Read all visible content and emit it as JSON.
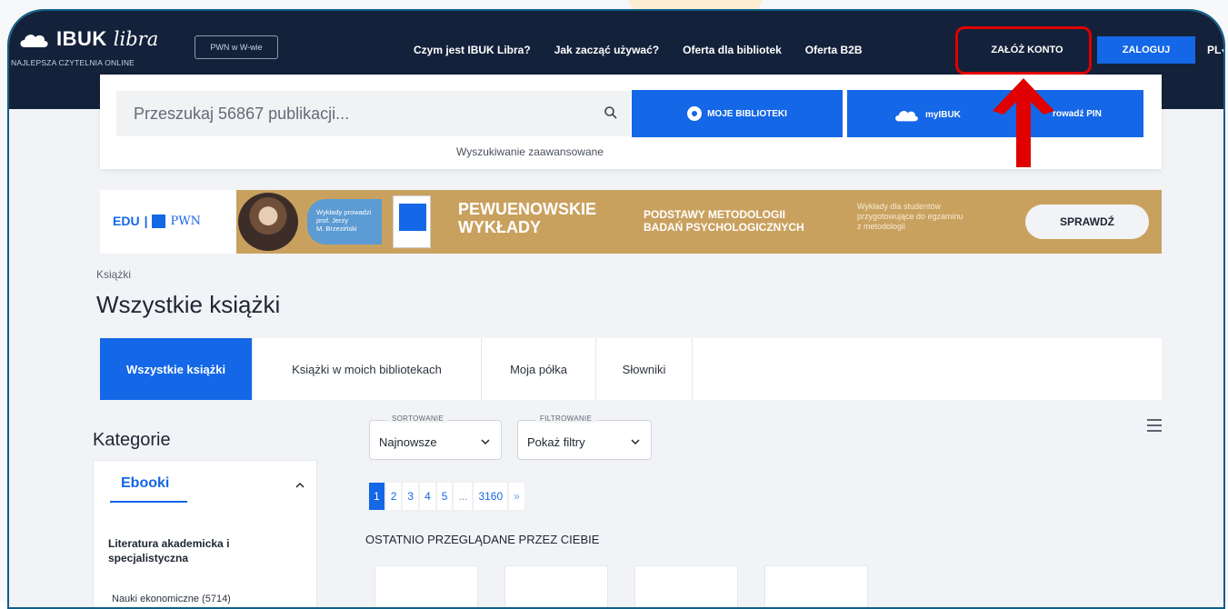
{
  "header": {
    "logo_main": "IBUK",
    "logo_script": "libra",
    "tagline": "NAJLEPSZA CZYTELNIA ONLINE",
    "pwn_button": "PWN w W-wie",
    "nav": [
      "Czym jest IBUK Libra?",
      "Jak zacząć używać?",
      "Oferta dla bibliotek",
      "Oferta B2B"
    ],
    "register_button": "ZAŁÓŻ KONTO",
    "login_button": "ZALOGUJ",
    "language": "PL"
  },
  "search": {
    "placeholder": "Przeszukaj 56867 publikacji...",
    "advanced_link": "Wyszukiwanie zaawansowane",
    "my_libraries_button": "MOJE BIBLIOTEKI",
    "mybuk_button": "myIBUK",
    "pin_button": "rowadź PIN"
  },
  "banner": {
    "brand": "EDU",
    "brand2": "PWN",
    "lecturer_line1": "Wykłady prowadzi",
    "lecturer_line2": "prof. Jerzy",
    "lecturer_line3": "M. Brzeziński",
    "title_line1": "PEWUENOWSKIE",
    "title_line2": "WYKŁADY",
    "subtitle_line1": "PODSTAWY METODOLOGII",
    "subtitle_line2": "BADAŃ PSYCHOLOGICZNYCH",
    "desc_line1": "Wykłady dla studentów",
    "desc_line2": "przygotowujące do egzaminu",
    "desc_line3": "z metodologii",
    "cta": "SPRAWDŹ"
  },
  "page": {
    "breadcrumb": "Książki",
    "title": "Wszystkie książki"
  },
  "tabs": [
    {
      "label": "Wszystkie książki",
      "active": true
    },
    {
      "label": "Książki w moich bibliotekach",
      "active": false
    },
    {
      "label": "Moja półka",
      "active": false
    },
    {
      "label": "Słowniki",
      "active": false
    }
  ],
  "sidebar": {
    "heading": "Kategorie",
    "section": "Ebooki",
    "main_category": "Literatura akademicka i specjalistyczna",
    "sub_category": "Nauki ekonomiczne (5714)"
  },
  "controls": {
    "sort_label": "SORTOWANIE",
    "sort_value": "Najnowsze",
    "filter_label": "FILTROWANIE",
    "filter_value": "Pokaż filtry"
  },
  "pagination": [
    "1",
    "2",
    "3",
    "4",
    "5",
    "...",
    "3160",
    "»"
  ],
  "recent": {
    "title": "OSTATNIO PRZEGLĄDANE PRZEZ CIEBIE"
  },
  "colors": {
    "primary": "#1467e6",
    "header": "#14213a",
    "banner": "#c9a15f",
    "highlight": "#e00000"
  }
}
